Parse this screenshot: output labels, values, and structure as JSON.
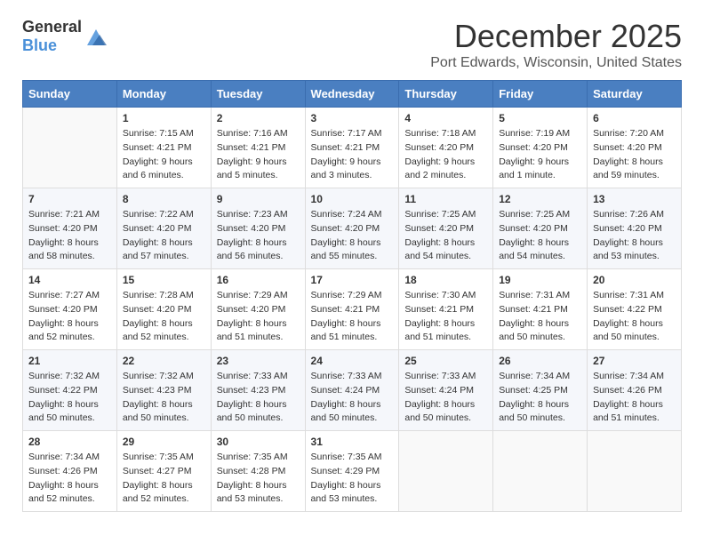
{
  "header": {
    "logo_general": "General",
    "logo_blue": "Blue",
    "title": "December 2025",
    "subtitle": "Port Edwards, Wisconsin, United States"
  },
  "calendar": {
    "weekdays": [
      "Sunday",
      "Monday",
      "Tuesday",
      "Wednesday",
      "Thursday",
      "Friday",
      "Saturday"
    ],
    "rows": [
      [
        {
          "day": "",
          "info": ""
        },
        {
          "day": "1",
          "info": "Sunrise: 7:15 AM\nSunset: 4:21 PM\nDaylight: 9 hours\nand 6 minutes."
        },
        {
          "day": "2",
          "info": "Sunrise: 7:16 AM\nSunset: 4:21 PM\nDaylight: 9 hours\nand 5 minutes."
        },
        {
          "day": "3",
          "info": "Sunrise: 7:17 AM\nSunset: 4:21 PM\nDaylight: 9 hours\nand 3 minutes."
        },
        {
          "day": "4",
          "info": "Sunrise: 7:18 AM\nSunset: 4:20 PM\nDaylight: 9 hours\nand 2 minutes."
        },
        {
          "day": "5",
          "info": "Sunrise: 7:19 AM\nSunset: 4:20 PM\nDaylight: 9 hours\nand 1 minute."
        },
        {
          "day": "6",
          "info": "Sunrise: 7:20 AM\nSunset: 4:20 PM\nDaylight: 8 hours\nand 59 minutes."
        }
      ],
      [
        {
          "day": "7",
          "info": "Sunrise: 7:21 AM\nSunset: 4:20 PM\nDaylight: 8 hours\nand 58 minutes."
        },
        {
          "day": "8",
          "info": "Sunrise: 7:22 AM\nSunset: 4:20 PM\nDaylight: 8 hours\nand 57 minutes."
        },
        {
          "day": "9",
          "info": "Sunrise: 7:23 AM\nSunset: 4:20 PM\nDaylight: 8 hours\nand 56 minutes."
        },
        {
          "day": "10",
          "info": "Sunrise: 7:24 AM\nSunset: 4:20 PM\nDaylight: 8 hours\nand 55 minutes."
        },
        {
          "day": "11",
          "info": "Sunrise: 7:25 AM\nSunset: 4:20 PM\nDaylight: 8 hours\nand 54 minutes."
        },
        {
          "day": "12",
          "info": "Sunrise: 7:25 AM\nSunset: 4:20 PM\nDaylight: 8 hours\nand 54 minutes."
        },
        {
          "day": "13",
          "info": "Sunrise: 7:26 AM\nSunset: 4:20 PM\nDaylight: 8 hours\nand 53 minutes."
        }
      ],
      [
        {
          "day": "14",
          "info": "Sunrise: 7:27 AM\nSunset: 4:20 PM\nDaylight: 8 hours\nand 52 minutes."
        },
        {
          "day": "15",
          "info": "Sunrise: 7:28 AM\nSunset: 4:20 PM\nDaylight: 8 hours\nand 52 minutes."
        },
        {
          "day": "16",
          "info": "Sunrise: 7:29 AM\nSunset: 4:20 PM\nDaylight: 8 hours\nand 51 minutes."
        },
        {
          "day": "17",
          "info": "Sunrise: 7:29 AM\nSunset: 4:21 PM\nDaylight: 8 hours\nand 51 minutes."
        },
        {
          "day": "18",
          "info": "Sunrise: 7:30 AM\nSunset: 4:21 PM\nDaylight: 8 hours\nand 51 minutes."
        },
        {
          "day": "19",
          "info": "Sunrise: 7:31 AM\nSunset: 4:21 PM\nDaylight: 8 hours\nand 50 minutes."
        },
        {
          "day": "20",
          "info": "Sunrise: 7:31 AM\nSunset: 4:22 PM\nDaylight: 8 hours\nand 50 minutes."
        }
      ],
      [
        {
          "day": "21",
          "info": "Sunrise: 7:32 AM\nSunset: 4:22 PM\nDaylight: 8 hours\nand 50 minutes."
        },
        {
          "day": "22",
          "info": "Sunrise: 7:32 AM\nSunset: 4:23 PM\nDaylight: 8 hours\nand 50 minutes."
        },
        {
          "day": "23",
          "info": "Sunrise: 7:33 AM\nSunset: 4:23 PM\nDaylight: 8 hours\nand 50 minutes."
        },
        {
          "day": "24",
          "info": "Sunrise: 7:33 AM\nSunset: 4:24 PM\nDaylight: 8 hours\nand 50 minutes."
        },
        {
          "day": "25",
          "info": "Sunrise: 7:33 AM\nSunset: 4:24 PM\nDaylight: 8 hours\nand 50 minutes."
        },
        {
          "day": "26",
          "info": "Sunrise: 7:34 AM\nSunset: 4:25 PM\nDaylight: 8 hours\nand 50 minutes."
        },
        {
          "day": "27",
          "info": "Sunrise: 7:34 AM\nSunset: 4:26 PM\nDaylight: 8 hours\nand 51 minutes."
        }
      ],
      [
        {
          "day": "28",
          "info": "Sunrise: 7:34 AM\nSunset: 4:26 PM\nDaylight: 8 hours\nand 52 minutes."
        },
        {
          "day": "29",
          "info": "Sunrise: 7:35 AM\nSunset: 4:27 PM\nDaylight: 8 hours\nand 52 minutes."
        },
        {
          "day": "30",
          "info": "Sunrise: 7:35 AM\nSunset: 4:28 PM\nDaylight: 8 hours\nand 53 minutes."
        },
        {
          "day": "31",
          "info": "Sunrise: 7:35 AM\nSunset: 4:29 PM\nDaylight: 8 hours\nand 53 minutes."
        },
        {
          "day": "",
          "info": ""
        },
        {
          "day": "",
          "info": ""
        },
        {
          "day": "",
          "info": ""
        }
      ]
    ]
  }
}
